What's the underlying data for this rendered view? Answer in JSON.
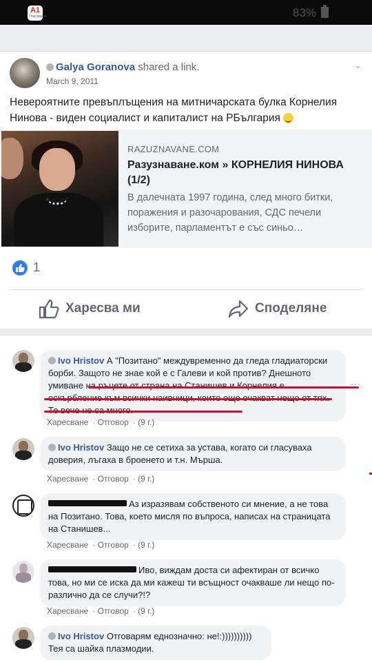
{
  "status_bar": {
    "app_badge": "A1",
    "app_badge_sub": "Гласувайте",
    "battery": "83%"
  },
  "post": {
    "author": "Galya Goranova",
    "action": "shared a link.",
    "date": "March 9, 2011",
    "text": "Невероятните превъплъщения на митничарската булка Корнелия Нинова - виден социалист и капиталист на РБългария",
    "link": {
      "domain": "RAZUZNAVANE.COM",
      "title": "Разузнаване.ком » КОРНЕЛИЯ НИНОВА (1/2)",
      "description": "В далечната 1997 година, след много битки, поражения и разочарования, СДС печели изборите, парламентът е със синьо…"
    },
    "like_count": "1",
    "actions": {
      "like": "Харесва ми",
      "share": "Споделяне"
    }
  },
  "comments": [
    {
      "author": "Ivo Hristov",
      "text": "А \"Позитано\" междувременно да гледа гладиаторски борби. Защото не знае кой е с Галеви и кой против? Днешното умиване на ръцете от страна на Станишев и Корнелия е оскърбление към всички наивници, които още очакват нещо от тях. Те вече не са много.",
      "like": "Харесване",
      "reply": "Отговор",
      "time": "(9 г.)"
    },
    {
      "author": "Ivo Hristov",
      "text": "Защо не се сетиха за устава, когато си гласуваха доверия, лъгаха в броенето и т.н. Мърша.",
      "like": "Харесване",
      "reply": "Отговор",
      "time": "(9 г.)"
    },
    {
      "author": "",
      "text": "Аз изразявам собственото си мнение, а не това на Позитано. Това, което мисля по въпроса, написах на страницата на Станишев...",
      "like": "Харесване",
      "reply": "Отговор",
      "time": "(9 г.)"
    },
    {
      "author": "",
      "text": "Иво, виждам доста си афектиран от всичко това, но ми се иска да ми кажеш ти всъщност очакваше ли нещо по-различно да се случи?!?",
      "like": "Харесване",
      "reply": "Отговор",
      "time": "(9 г.)"
    },
    {
      "author": "Ivo Hristov",
      "text": "Отговарям еднозначно: не!:)))))))))) Тея са шайка плазмодии.",
      "like": "",
      "reply": "",
      "time": ""
    }
  ],
  "colors": {
    "link_blue": "#385898",
    "like_blue": "#2e7bf6",
    "underline_red": "#c8102e",
    "feed_bg": "#e9ebee"
  },
  "icons": [
    "thumbs-up-icon",
    "share-icon",
    "verified-icon",
    "chevron-down-icon",
    "more-icon",
    "smiley-icon",
    "battery-icon"
  ]
}
